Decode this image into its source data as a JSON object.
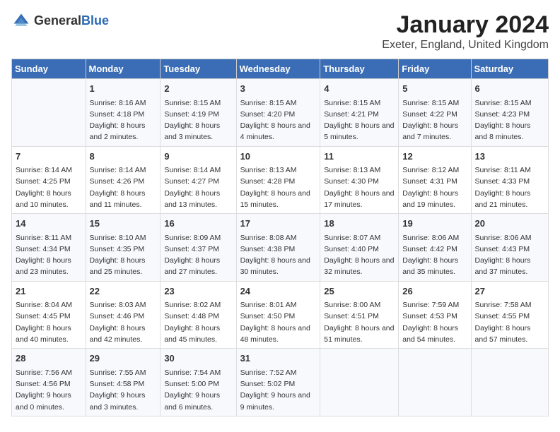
{
  "logo": {
    "text_general": "General",
    "text_blue": "Blue"
  },
  "title": "January 2024",
  "location": "Exeter, England, United Kingdom",
  "days_of_week": [
    "Sunday",
    "Monday",
    "Tuesday",
    "Wednesday",
    "Thursday",
    "Friday",
    "Saturday"
  ],
  "weeks": [
    [
      {
        "day": "",
        "sunrise": "",
        "sunset": "",
        "daylight": ""
      },
      {
        "day": "1",
        "sunrise": "Sunrise: 8:16 AM",
        "sunset": "Sunset: 4:18 PM",
        "daylight": "Daylight: 8 hours and 2 minutes."
      },
      {
        "day": "2",
        "sunrise": "Sunrise: 8:15 AM",
        "sunset": "Sunset: 4:19 PM",
        "daylight": "Daylight: 8 hours and 3 minutes."
      },
      {
        "day": "3",
        "sunrise": "Sunrise: 8:15 AM",
        "sunset": "Sunset: 4:20 PM",
        "daylight": "Daylight: 8 hours and 4 minutes."
      },
      {
        "day": "4",
        "sunrise": "Sunrise: 8:15 AM",
        "sunset": "Sunset: 4:21 PM",
        "daylight": "Daylight: 8 hours and 5 minutes."
      },
      {
        "day": "5",
        "sunrise": "Sunrise: 8:15 AM",
        "sunset": "Sunset: 4:22 PM",
        "daylight": "Daylight: 8 hours and 7 minutes."
      },
      {
        "day": "6",
        "sunrise": "Sunrise: 8:15 AM",
        "sunset": "Sunset: 4:23 PM",
        "daylight": "Daylight: 8 hours and 8 minutes."
      }
    ],
    [
      {
        "day": "7",
        "sunrise": "Sunrise: 8:14 AM",
        "sunset": "Sunset: 4:25 PM",
        "daylight": "Daylight: 8 hours and 10 minutes."
      },
      {
        "day": "8",
        "sunrise": "Sunrise: 8:14 AM",
        "sunset": "Sunset: 4:26 PM",
        "daylight": "Daylight: 8 hours and 11 minutes."
      },
      {
        "day": "9",
        "sunrise": "Sunrise: 8:14 AM",
        "sunset": "Sunset: 4:27 PM",
        "daylight": "Daylight: 8 hours and 13 minutes."
      },
      {
        "day": "10",
        "sunrise": "Sunrise: 8:13 AM",
        "sunset": "Sunset: 4:28 PM",
        "daylight": "Daylight: 8 hours and 15 minutes."
      },
      {
        "day": "11",
        "sunrise": "Sunrise: 8:13 AM",
        "sunset": "Sunset: 4:30 PM",
        "daylight": "Daylight: 8 hours and 17 minutes."
      },
      {
        "day": "12",
        "sunrise": "Sunrise: 8:12 AM",
        "sunset": "Sunset: 4:31 PM",
        "daylight": "Daylight: 8 hours and 19 minutes."
      },
      {
        "day": "13",
        "sunrise": "Sunrise: 8:11 AM",
        "sunset": "Sunset: 4:33 PM",
        "daylight": "Daylight: 8 hours and 21 minutes."
      }
    ],
    [
      {
        "day": "14",
        "sunrise": "Sunrise: 8:11 AM",
        "sunset": "Sunset: 4:34 PM",
        "daylight": "Daylight: 8 hours and 23 minutes."
      },
      {
        "day": "15",
        "sunrise": "Sunrise: 8:10 AM",
        "sunset": "Sunset: 4:35 PM",
        "daylight": "Daylight: 8 hours and 25 minutes."
      },
      {
        "day": "16",
        "sunrise": "Sunrise: 8:09 AM",
        "sunset": "Sunset: 4:37 PM",
        "daylight": "Daylight: 8 hours and 27 minutes."
      },
      {
        "day": "17",
        "sunrise": "Sunrise: 8:08 AM",
        "sunset": "Sunset: 4:38 PM",
        "daylight": "Daylight: 8 hours and 30 minutes."
      },
      {
        "day": "18",
        "sunrise": "Sunrise: 8:07 AM",
        "sunset": "Sunset: 4:40 PM",
        "daylight": "Daylight: 8 hours and 32 minutes."
      },
      {
        "day": "19",
        "sunrise": "Sunrise: 8:06 AM",
        "sunset": "Sunset: 4:42 PM",
        "daylight": "Daylight: 8 hours and 35 minutes."
      },
      {
        "day": "20",
        "sunrise": "Sunrise: 8:06 AM",
        "sunset": "Sunset: 4:43 PM",
        "daylight": "Daylight: 8 hours and 37 minutes."
      }
    ],
    [
      {
        "day": "21",
        "sunrise": "Sunrise: 8:04 AM",
        "sunset": "Sunset: 4:45 PM",
        "daylight": "Daylight: 8 hours and 40 minutes."
      },
      {
        "day": "22",
        "sunrise": "Sunrise: 8:03 AM",
        "sunset": "Sunset: 4:46 PM",
        "daylight": "Daylight: 8 hours and 42 minutes."
      },
      {
        "day": "23",
        "sunrise": "Sunrise: 8:02 AM",
        "sunset": "Sunset: 4:48 PM",
        "daylight": "Daylight: 8 hours and 45 minutes."
      },
      {
        "day": "24",
        "sunrise": "Sunrise: 8:01 AM",
        "sunset": "Sunset: 4:50 PM",
        "daylight": "Daylight: 8 hours and 48 minutes."
      },
      {
        "day": "25",
        "sunrise": "Sunrise: 8:00 AM",
        "sunset": "Sunset: 4:51 PM",
        "daylight": "Daylight: 8 hours and 51 minutes."
      },
      {
        "day": "26",
        "sunrise": "Sunrise: 7:59 AM",
        "sunset": "Sunset: 4:53 PM",
        "daylight": "Daylight: 8 hours and 54 minutes."
      },
      {
        "day": "27",
        "sunrise": "Sunrise: 7:58 AM",
        "sunset": "Sunset: 4:55 PM",
        "daylight": "Daylight: 8 hours and 57 minutes."
      }
    ],
    [
      {
        "day": "28",
        "sunrise": "Sunrise: 7:56 AM",
        "sunset": "Sunset: 4:56 PM",
        "daylight": "Daylight: 9 hours and 0 minutes."
      },
      {
        "day": "29",
        "sunrise": "Sunrise: 7:55 AM",
        "sunset": "Sunset: 4:58 PM",
        "daylight": "Daylight: 9 hours and 3 minutes."
      },
      {
        "day": "30",
        "sunrise": "Sunrise: 7:54 AM",
        "sunset": "Sunset: 5:00 PM",
        "daylight": "Daylight: 9 hours and 6 minutes."
      },
      {
        "day": "31",
        "sunrise": "Sunrise: 7:52 AM",
        "sunset": "Sunset: 5:02 PM",
        "daylight": "Daylight: 9 hours and 9 minutes."
      },
      {
        "day": "",
        "sunrise": "",
        "sunset": "",
        "daylight": ""
      },
      {
        "day": "",
        "sunrise": "",
        "sunset": "",
        "daylight": ""
      },
      {
        "day": "",
        "sunrise": "",
        "sunset": "",
        "daylight": ""
      }
    ]
  ]
}
